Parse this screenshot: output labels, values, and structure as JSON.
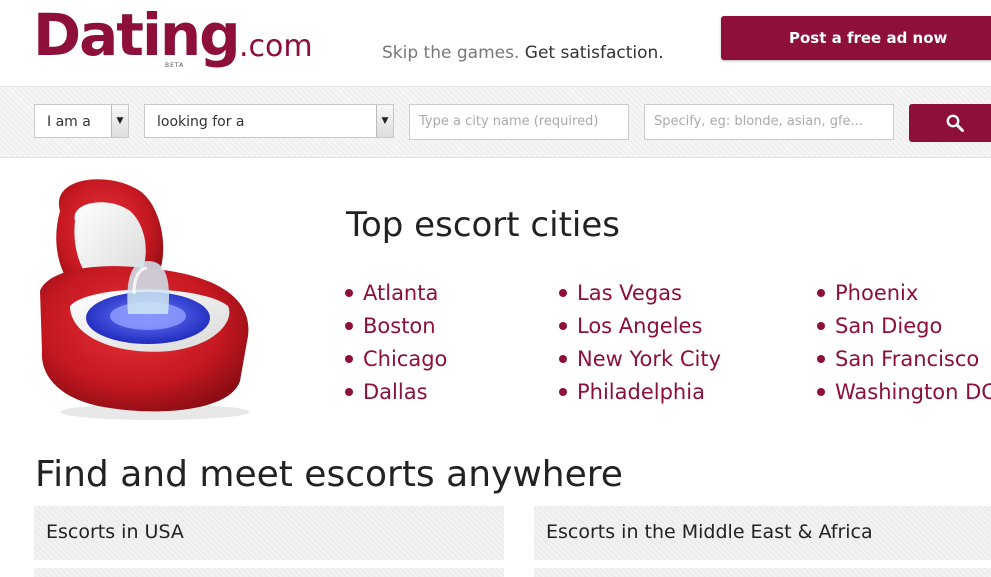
{
  "brand": {
    "logo_text": "Dating",
    "logo_suffix": ".com",
    "logo_badge": "BETA",
    "colors": {
      "accent": "#8d0f3a",
      "text": "#222222"
    }
  },
  "header": {
    "tagline_part1": "Skip the games.",
    "tagline_part2": "Get satisfaction.",
    "post_ad_label": "Post a free ad now"
  },
  "search": {
    "gender_select": {
      "selected": "I am a"
    },
    "looking_select": {
      "selected": "looking for a"
    },
    "city_placeholder": "Type a city name (required)",
    "specify_placeholder": "Specify, eg: blonde, asian, gfe...",
    "button_icon": "search-icon"
  },
  "hero": {
    "image": "condom-in-ring-box",
    "title": "Top escort cities",
    "cities_col1": [
      "Atlanta",
      "Boston",
      "Chicago",
      "Dallas"
    ],
    "cities_col2": [
      "Las Vegas",
      "Los Angeles",
      "New York City",
      "Philadelphia"
    ],
    "cities_col3": [
      "Phoenix",
      "San Diego",
      "San Francisco",
      "Washington DC"
    ]
  },
  "regions": {
    "title": "Find and meet escorts anywhere",
    "items": [
      "Escorts in USA",
      "Escorts in the Middle East & Africa"
    ]
  }
}
